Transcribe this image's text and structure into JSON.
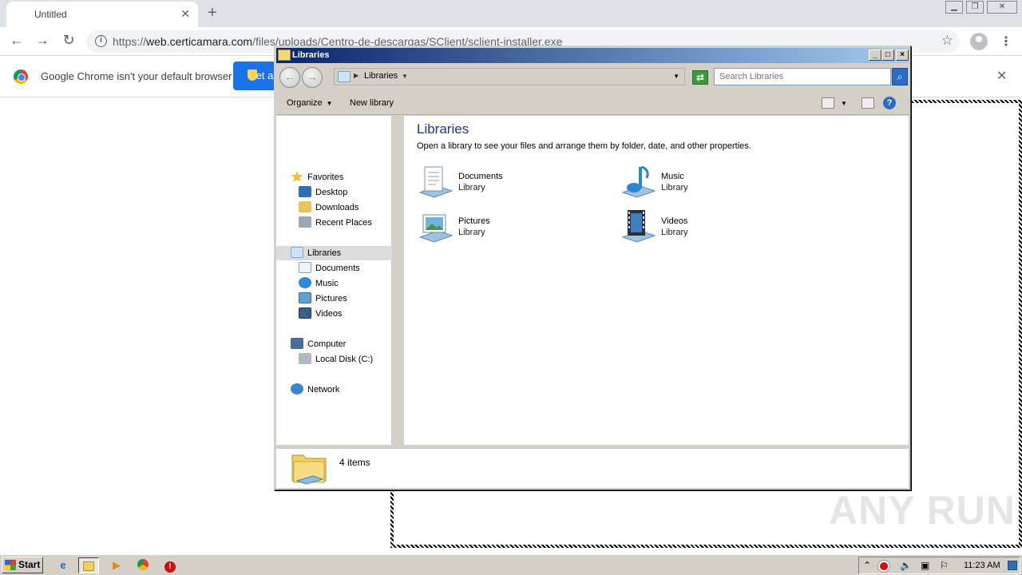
{
  "browser": {
    "tab_title": "Untitled",
    "tab_close": "✕",
    "new_tab": "+",
    "url_prefix": "https://",
    "url_host": "web.certicamara.com",
    "url_path": "/files/uploads/Centro-de-descargas/SClient/sclient-installer.exe",
    "infobar_message": "Google Chrome isn't your default browser",
    "infobar_button_label": "Set as default"
  },
  "explorer": {
    "window_title": "Libraries",
    "breadcrumb": "Libraries",
    "search_placeholder": "Search Libraries",
    "commands": {
      "organize": "Organize",
      "new_library": "New library"
    },
    "nav": {
      "favorites": "Favorites",
      "desktop": "Desktop",
      "downloads": "Downloads",
      "recent_places": "Recent Places",
      "libraries": "Libraries",
      "documents": "Documents",
      "music": "Music",
      "pictures": "Pictures",
      "videos": "Videos",
      "computer": "Computer",
      "local_disk": "Local Disk (C:)",
      "network": "Network"
    },
    "heading": "Libraries",
    "description": "Open a library to see your files and arrange them by folder, date, and other properties.",
    "libraries": [
      {
        "name": "Documents",
        "type": "Library",
        "icon": "documents-library-icon"
      },
      {
        "name": "Music",
        "type": "Library",
        "icon": "music-library-icon"
      },
      {
        "name": "Pictures",
        "type": "Library",
        "icon": "pictures-library-icon"
      },
      {
        "name": "Videos",
        "type": "Library",
        "icon": "videos-library-icon"
      }
    ],
    "item_count": "4 items"
  },
  "taskbar": {
    "start_label": "Start",
    "clock": "11:23 AM"
  },
  "watermark": "ANY RUN"
}
